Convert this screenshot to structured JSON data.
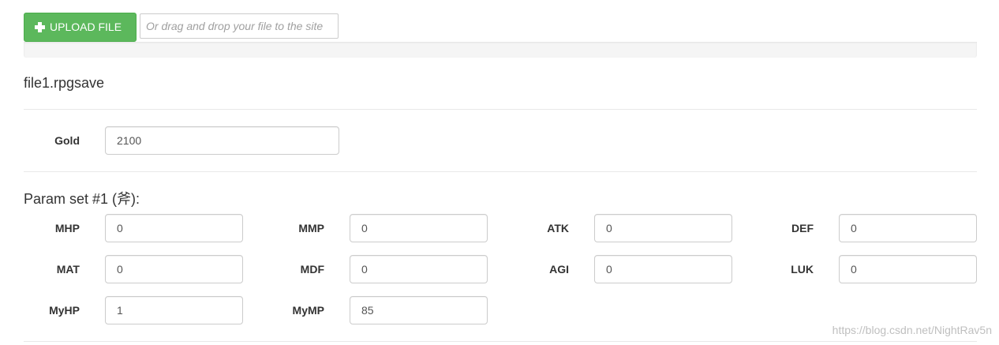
{
  "upload": {
    "button_label": "UPLOAD FILE",
    "drop_placeholder": "Or drag and drop your file to the site"
  },
  "file": {
    "name": "file1.rpgsave"
  },
  "gold": {
    "label": "Gold",
    "value": "2100"
  },
  "param_set": {
    "title": "Param set #1 (斧):",
    "fields": [
      {
        "label": "MHP",
        "value": "0"
      },
      {
        "label": "MMP",
        "value": "0"
      },
      {
        "label": "ATK",
        "value": "0"
      },
      {
        "label": "DEF",
        "value": "0"
      },
      {
        "label": "MAT",
        "value": "0"
      },
      {
        "label": "MDF",
        "value": "0"
      },
      {
        "label": "AGI",
        "value": "0"
      },
      {
        "label": "LUK",
        "value": "0"
      },
      {
        "label": "MyHP",
        "value": "1"
      },
      {
        "label": "MyMP",
        "value": "85"
      }
    ]
  },
  "watermark": "https://blog.csdn.net/NightRav5n",
  "colors": {
    "upload_button": "#5cb85c",
    "border": "#cccccc"
  }
}
